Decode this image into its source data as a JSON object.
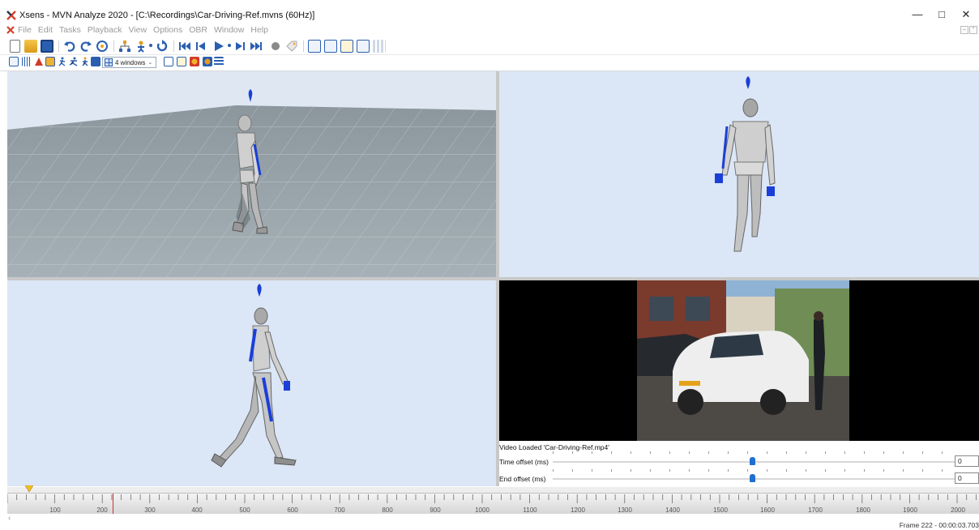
{
  "window": {
    "title": "Xsens - MVN Analyze 2020 - [C:\\Recordings\\Car-Driving-Ref.mvns (60Hz)]",
    "controls": [
      "—",
      "□",
      "✕"
    ]
  },
  "menu": {
    "items": [
      "File",
      "Edit",
      "Tasks",
      "Playback",
      "View",
      "Options",
      "OBR",
      "Window",
      "Help"
    ],
    "mdi_controls": [
      "–",
      "°"
    ]
  },
  "toolbar2": {
    "window_layout": "4 windows"
  },
  "video_panel": {
    "status": "Video Loaded 'Car-Driving-Ref.mp4'",
    "time_offset_label": "Time offset (ms)",
    "time_offset_value": "0",
    "end_offset_label": "End offset (ms)",
    "end_offset_value": "0"
  },
  "timeline": {
    "labels": [
      "100",
      "200",
      "300",
      "400",
      "500",
      "600",
      "700",
      "800",
      "900",
      "1000",
      "1100",
      "1200",
      "1300",
      "1400",
      "1500",
      "1600",
      "1700",
      "1800",
      "1900",
      "2000"
    ]
  },
  "status_bar": {
    "text": "Frame 222 - 00:00:03.703"
  },
  "colors": {
    "accent": "#1f6fd1",
    "app_logo": "#d4402a",
    "marker": "#1a3fd8",
    "playhead": "#d03030"
  }
}
